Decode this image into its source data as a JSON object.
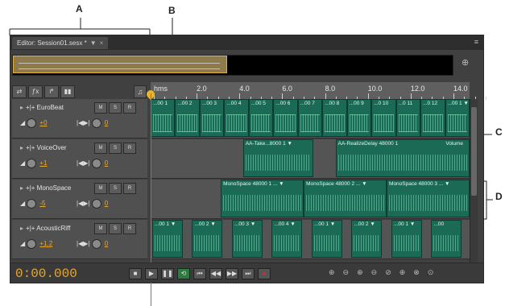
{
  "callouts": {
    "a": "A",
    "b": "B",
    "c": "C",
    "d": "D"
  },
  "editor": {
    "tab_title": "Editor: Session01.sesx *",
    "tab_dropdown": "▼",
    "tab_close": "×",
    "panel_menu": "≡"
  },
  "ruler": {
    "labels": [
      "hms",
      "2.0",
      "4.0",
      "6.0",
      "8.0",
      "10.0",
      "12.0",
      "14.0"
    ]
  },
  "tracks": [
    {
      "name": "EuroBeat",
      "volume": "+0",
      "pan": "0",
      "clips": [
        "...00 1",
        "...00 2",
        "...00 3",
        "...00 4",
        "...00 5",
        "...00 6",
        "...00 7",
        "...00 8",
        "...00 9",
        "...0 10",
        "...0 11",
        "...0 12",
        "...00 1 ▼"
      ]
    },
    {
      "name": "VoiceOver",
      "volume": "+1",
      "pan": "0",
      "clips": [
        "AA-Take...8000 1 ▼",
        "AA-RealizeDelay 48000 1",
        "Volume"
      ]
    },
    {
      "name": "MonoSpace",
      "volume": "-5",
      "pan": "0",
      "clips": [
        "MonoSpace 48000 1 ... ▼",
        "MonoSpace 48000 2 ... ▼",
        "MonoSpace 48000 3 ... ▼"
      ]
    },
    {
      "name": "AcousticRiff",
      "volume": "+1.2",
      "pan": "0",
      "clips": [
        "...00 1 ▼",
        "...00 2 ▼",
        "...00 3 ▼",
        "...00 4 ▼",
        "...00 1 ▼",
        "...00 2 ▼",
        "...00 1 ▼",
        "...00"
      ]
    }
  ],
  "track_buttons": {
    "mute": "M",
    "solo": "S",
    "record": "R"
  },
  "transport": {
    "time": "0:00.000"
  },
  "colors": {
    "accent": "#e8a82f",
    "clip": "#1b6a55",
    "playhead": "#d35a2a"
  },
  "icons": [
    "metronome-icon",
    "zoom-in-icon",
    "zoom-out-icon"
  ]
}
